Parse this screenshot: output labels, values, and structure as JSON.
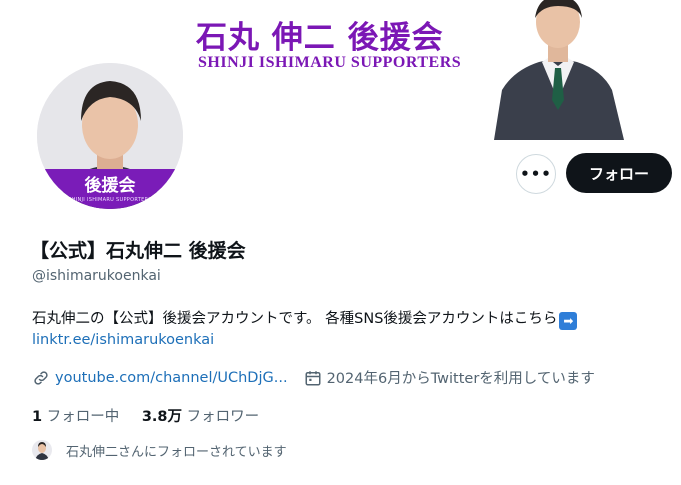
{
  "banner": {
    "title": "石丸 伸二 後援会",
    "subtitle": "SHINJI ISHIMARU SUPPORTERS"
  },
  "avatar": {
    "band_text": "後援会",
    "band_small_text": "SHINJI ISHIMARU SUPPORTERS"
  },
  "actions": {
    "more_label": "•••",
    "follow_label": "フォロー"
  },
  "profile": {
    "name": "【公式】石丸伸二 後援会",
    "handle": "@ishimarukoenkai",
    "bio": "石丸伸二の【公式】後援会アカウントです。 各種SNS後援会アカウントはこちら",
    "bio_link": "linktr.ee/ishimarukoenkai",
    "website": "youtube.com/channel/UChDjG...",
    "joined": "2024年6月からTwitterを利用しています"
  },
  "counts": {
    "following_count": "1",
    "following_label": "フォロー中",
    "followers_count": "3.8万",
    "followers_label": "フォロワー"
  },
  "followed_by": {
    "text": "石丸伸二さんにフォローされています"
  },
  "colors": {
    "brand_purple": "#7b17b5",
    "link_blue": "#1d6fb8",
    "follow_button": "#0f1419"
  },
  "icons": {
    "link": "link-icon",
    "calendar": "calendar-icon",
    "arrow": "right-arrow-icon"
  }
}
